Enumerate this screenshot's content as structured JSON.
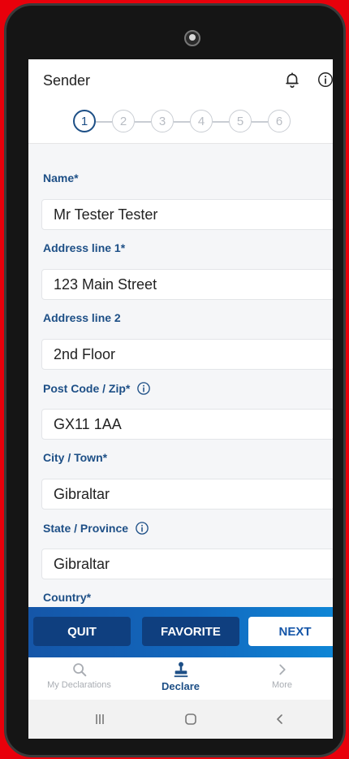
{
  "header": {
    "title": "Sender",
    "icons": [
      "bell-icon",
      "info-icon"
    ]
  },
  "stepper": {
    "steps": [
      "1",
      "2",
      "3",
      "4",
      "5",
      "6"
    ],
    "current": 1
  },
  "form": {
    "name": {
      "label": "Name*",
      "value": "Mr Tester Tester"
    },
    "address1": {
      "label": "Address line 1*",
      "value": "123 Main Street"
    },
    "address2": {
      "label": "Address line 2",
      "value": "2nd Floor"
    },
    "postcode": {
      "label": "Post Code / Zip*",
      "value": "GX11 1AA",
      "icon": "info-icon"
    },
    "city": {
      "label": "City / Town*",
      "value": "Gibraltar"
    },
    "state": {
      "label": "State / Province",
      "value": "Gibraltar",
      "icon": "info-icon"
    },
    "country": {
      "label": "Country*"
    }
  },
  "actions": {
    "quit": "QUIT",
    "favorite": "FAVORITE",
    "next": "NEXT"
  },
  "bottom_nav": {
    "items": [
      {
        "label": "My Declarations",
        "icon": "search-icon"
      },
      {
        "label": "Declare",
        "icon": "stamp-icon",
        "active": true
      },
      {
        "label": "More",
        "icon": "chevron-right-icon"
      }
    ]
  },
  "system_nav": [
    "recents-icon",
    "home-icon",
    "back-icon"
  ],
  "colors": {
    "background": "#e8000b",
    "accent": "#1d4f86",
    "action_bar": "#1268be",
    "button_dark": "#0f3f7f"
  }
}
